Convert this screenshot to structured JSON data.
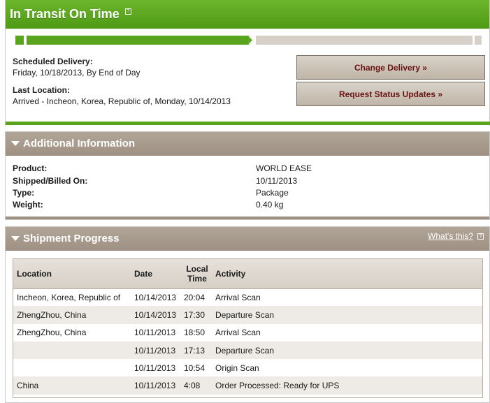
{
  "status": {
    "title": "In Transit On Time",
    "help_glyph": "?",
    "progress": 0.5,
    "colors": {
      "green": "#5aa51d",
      "track": "#d6d0c8",
      "button_text": "#6b1212"
    }
  },
  "delivery": {
    "scheduled_label": "Scheduled Delivery:",
    "scheduled_value": "Friday, 10/18/2013, By End of Day",
    "last_location_label": "Last Location:",
    "last_location_value": "Arrived - Incheon, Korea, Republic of, Monday, 10/14/2013"
  },
  "actions": {
    "change_delivery": "Change Delivery »",
    "request_updates": "Request Status Updates »"
  },
  "additional_info": {
    "title": "Additional Information",
    "rows": [
      {
        "label": "Product:",
        "value": "WORLD EASE"
      },
      {
        "label": "Shipped/Billed On:",
        "value": "10/11/2013"
      },
      {
        "label": "Type:",
        "value": "Package"
      },
      {
        "label": "Weight:",
        "value": "0.40 kg"
      }
    ]
  },
  "shipment_progress": {
    "title": "Shipment Progress",
    "whats_this": "What's this?",
    "columns": {
      "location": "Location",
      "date": "Date",
      "local_time_1": "Local",
      "local_time_2": "Time",
      "activity": "Activity"
    },
    "rows": [
      {
        "location": "Incheon, Korea, Republic of",
        "date": "10/14/2013",
        "time": "20:04",
        "activity": "Arrival Scan"
      },
      {
        "location": "ZhengZhou, China",
        "date": "10/14/2013",
        "time": "17:30",
        "activity": "Departure Scan"
      },
      {
        "location": "ZhengZhou, China",
        "date": "10/11/2013",
        "time": "18:50",
        "activity": "Arrival Scan"
      },
      {
        "location": "",
        "date": "10/11/2013",
        "time": "17:13",
        "activity": "Departure Scan"
      },
      {
        "location": "",
        "date": "10/11/2013",
        "time": "10:54",
        "activity": "Origin Scan"
      },
      {
        "location": "China",
        "date": "10/11/2013",
        "time": "4:08",
        "activity": "Order Processed: Ready for UPS"
      }
    ]
  }
}
